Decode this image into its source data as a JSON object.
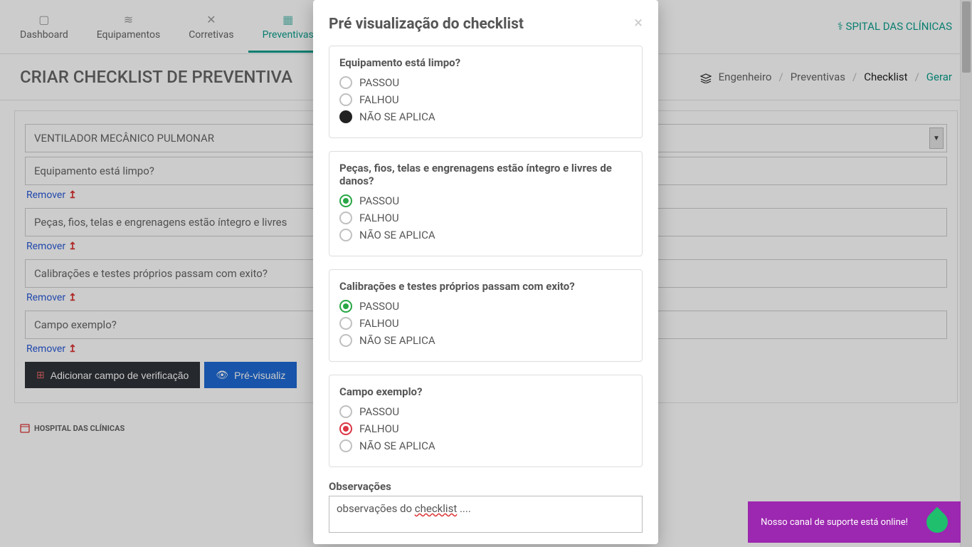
{
  "nav": {
    "items": [
      {
        "label": "Dashboard"
      },
      {
        "label": "Equipamentos"
      },
      {
        "label": "Corretivas"
      },
      {
        "label": "Preventivas"
      }
    ],
    "brand_suffix": "SPITAL DAS CLÍNICAS"
  },
  "page": {
    "title": "CRIAR CHECKLIST DE PREVENTIVA",
    "crumbs": {
      "engenheiro": "Engenheiro",
      "preventivas": "Preventivas",
      "checklist": "Checklist",
      "gerar": "Gerar",
      "sep": "/"
    }
  },
  "form": {
    "select_value": "VENTILADOR MECÂNICO PULMONAR",
    "fields": [
      "Equipamento está limpo?",
      "Peças, fios, telas e engrenagens estão íntegro e livres",
      "Calibrações e testes próprios passam com exito?",
      "Campo exemplo?"
    ],
    "remover": "Remover",
    "btn_add": "Adicionar campo de verificação",
    "btn_preview": "Pré-visualiz"
  },
  "footer": {
    "hospital": "HOSPITAL DAS CLÍNICAS"
  },
  "modal": {
    "title": "Pré visualização do checklist",
    "opts": {
      "pass": "PASSOU",
      "fail": "FALHOU",
      "na": "NÃO SE APLICA"
    },
    "questions": [
      {
        "q": "Equipamento está limpo?",
        "selected": "na"
      },
      {
        "q": "Peças, fios, telas e engrenagens estão íntegro e livres de danos?",
        "selected": "pass"
      },
      {
        "q": "Calibrações e testes próprios passam com exito?",
        "selected": "pass"
      },
      {
        "q": "Campo exemplo?",
        "selected": "fail"
      }
    ],
    "obs_label": "Observações",
    "obs_pre": "observações do ",
    "obs_word": "checklist",
    "obs_post": " ...."
  },
  "support": {
    "text": "Nosso canal de suporte está online!"
  }
}
